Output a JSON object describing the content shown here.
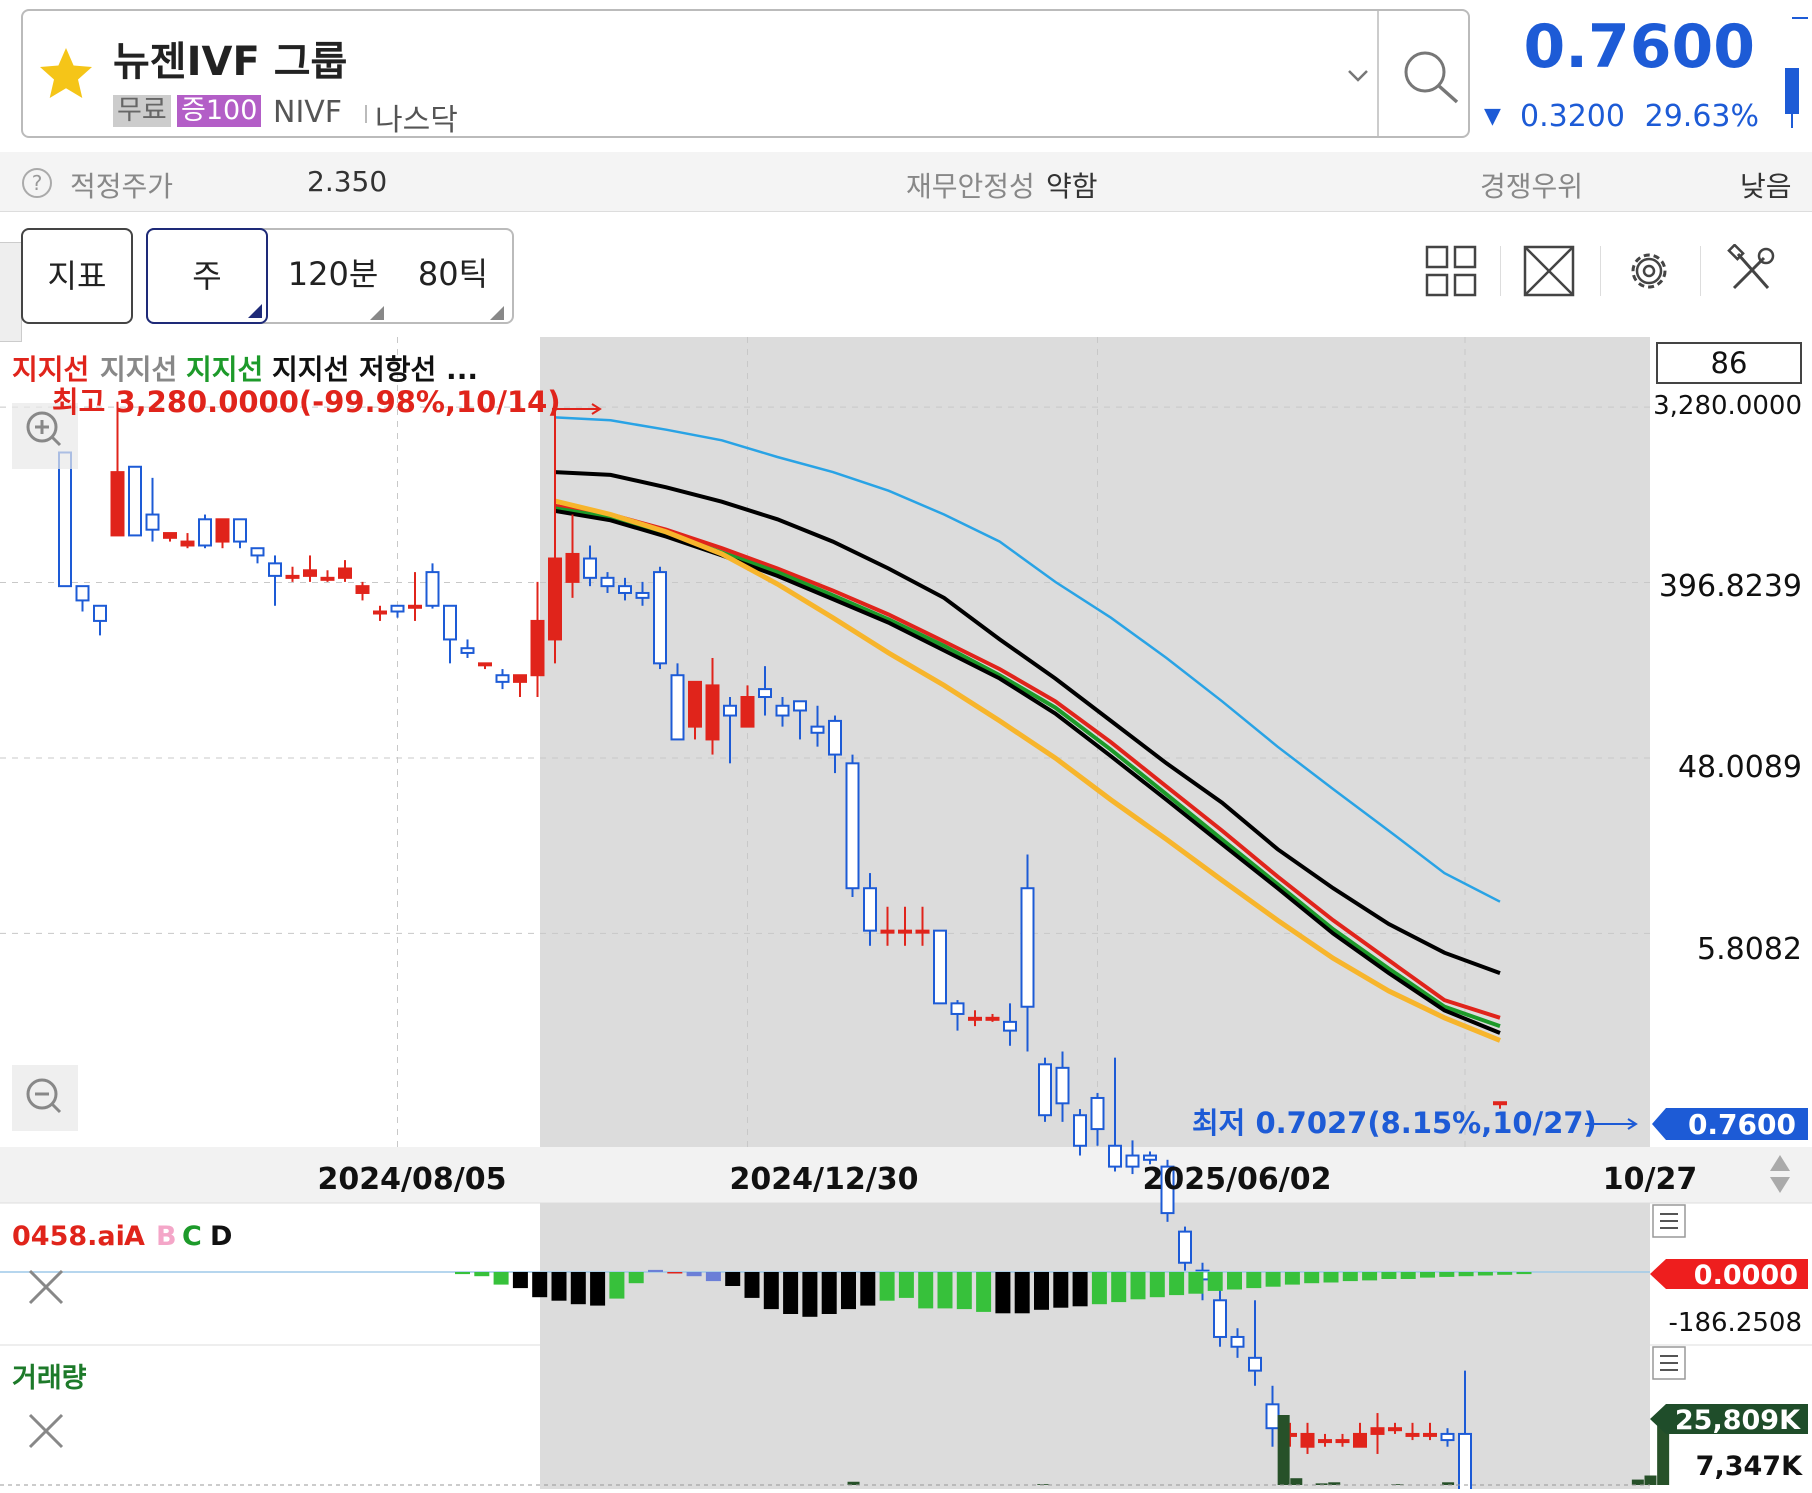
{
  "header": {
    "stock_name": "뉴젠IVF 그룹",
    "badge_free": "무료",
    "badge_margin": "증100",
    "ticker": "NIVF",
    "market": "나스닥",
    "price": "0.7600",
    "change": "0.3200",
    "change_pct": "29.63%",
    "colors": {
      "down": "#1d5bd6",
      "up": "#e0241b",
      "star": "#f5c518"
    }
  },
  "valuation": {
    "fair_price_label": "적정주가",
    "fair_price_value": "2.350",
    "stability_label": "재무안정성",
    "stability_value": "약함",
    "competitive_label": "경쟁우위",
    "competitive_value": "낮음"
  },
  "toolbar": {
    "indicator_label": "지표",
    "week_label": "주",
    "min120_label": "120분",
    "tick80_label": "80틱",
    "icons": [
      "layout-grid-icon",
      "expand-icon",
      "gear-icon",
      "tools-icon"
    ]
  },
  "chart": {
    "legend": [
      {
        "text": "지지선",
        "color": "#e0241b"
      },
      {
        "text": "지지선",
        "color": "#888888"
      },
      {
        "text": "지지선",
        "color": "#1d9a2a"
      },
      {
        "text": "지지선 저항선 ...",
        "color": "#111111"
      }
    ],
    "high_annotation": "최고 3,280.0000(-99.98%,10/14)",
    "low_annotation": "최저 0.7027(8.15%,10/27)",
    "count_box": "86",
    "current_price_tag": "0.7600",
    "y_ticks": [
      "3,280.0000",
      "396.8239",
      "48.0089",
      "5.8082"
    ],
    "x_ticks": [
      "2024/08/05",
      "2024/12/30",
      "2025/06/02",
      "10/27"
    ],
    "macd": {
      "title": "0458.ai",
      "legend": [
        {
          "text": "A",
          "color": "#e0241b"
        },
        {
          "text": "B",
          "color": "#f4a6c8"
        },
        {
          "text": "C",
          "color": "#1d9a2a"
        },
        {
          "text": "D",
          "color": "#111111"
        }
      ],
      "current_tag": "0.0000",
      "min_label": "-186.2508"
    },
    "volume": {
      "title": "거래량",
      "current_tag": "25,809K",
      "ref_label": "7,347K"
    }
  },
  "chart_data": {
    "type": "candlestick",
    "scale": "log",
    "ylim": [
      0.5,
      6000
    ],
    "y_ticks": [
      3280,
      396.8239,
      48.0089,
      5.8082
    ],
    "x_ticks": [
      "2024/08/05",
      "2024/12/30",
      "2025/06/02",
      "10/27"
    ],
    "x_tick_index": [
      19,
      39,
      59,
      80
    ],
    "candles": [
      [
        1900,
        380,
        1900,
        380
      ],
      [
        380,
        320,
        380,
        280
      ],
      [
        300,
        250,
        300,
        210
      ],
      [
        700,
        1500,
        3500,
        700
      ],
      [
        1600,
        700,
        1600,
        700
      ],
      [
        900,
        750,
        1400,
        650
      ],
      [
        680,
        720,
        720,
        650
      ],
      [
        620,
        650,
        720,
        600
      ],
      [
        850,
        620,
        900,
        600
      ],
      [
        650,
        850,
        850,
        600
      ],
      [
        850,
        650,
        850,
        600
      ],
      [
        600,
        550,
        600,
        500
      ],
      [
        500,
        430,
        550,
        300
      ],
      [
        430,
        430,
        480,
        400
      ],
      [
        430,
        460,
        550,
        400
      ],
      [
        420,
        420,
        460,
        400
      ],
      [
        420,
        470,
        520,
        400
      ],
      [
        350,
        380,
        400,
        320
      ],
      [
        280,
        280,
        300,
        250
      ],
      [
        300,
        280,
        300,
        260
      ],
      [
        300,
        300,
        450,
        250
      ],
      [
        450,
        300,
        500,
        290
      ],
      [
        300,
        200,
        300,
        150
      ],
      [
        180,
        170,
        200,
        160
      ],
      [
        150,
        150,
        150,
        140
      ],
      [
        130,
        120,
        140,
        110
      ],
      [
        120,
        130,
        130,
        100
      ],
      [
        130,
        250,
        400,
        100
      ],
      [
        200,
        530,
        3280,
        150
      ],
      [
        400,
        560,
        900,
        330
      ],
      [
        530,
        420,
        620,
        380
      ],
      [
        420,
        380,
        450,
        350
      ],
      [
        380,
        350,
        420,
        320
      ],
      [
        350,
        330,
        400,
        300
      ],
      [
        450,
        150,
        480,
        140
      ],
      [
        130,
        60,
        150,
        60
      ],
      [
        70,
        120,
        120,
        60
      ],
      [
        60,
        115,
        160,
        50
      ],
      [
        90,
        80,
        100,
        45
      ],
      [
        70,
        100,
        115,
        70
      ],
      [
        110,
        100,
        145,
        80
      ],
      [
        90,
        80,
        100,
        70
      ],
      [
        95,
        85,
        95,
        60
      ],
      [
        70,
        65,
        90,
        55
      ],
      [
        75,
        50,
        80,
        40
      ],
      [
        45,
        10,
        50,
        9
      ],
      [
        10,
        6,
        12,
        5
      ],
      [
        6,
        6,
        8,
        5
      ],
      [
        6,
        6,
        8,
        5
      ],
      [
        6,
        6,
        8,
        5
      ],
      [
        6,
        2.5,
        6,
        2.5
      ],
      [
        2.5,
        2.2,
        2.6,
        1.8
      ],
      [
        2.1,
        2.1,
        2.3,
        1.9
      ],
      [
        2.1,
        2.1,
        2.2,
        2
      ],
      [
        2,
        1.8,
        2.5,
        1.5
      ],
      [
        10,
        2.4,
        15,
        1.4
      ],
      [
        1.2,
        0.65,
        1.3,
        0.6
      ],
      [
        1.15,
        0.75,
        1.4,
        0.6
      ],
      [
        0.65,
        0.45,
        0.7,
        0.4
      ],
      [
        0.8,
        0.55,
        0.85,
        0.45
      ],
      [
        0.45,
        0.35,
        1.3,
        0.33
      ],
      [
        0.4,
        0.35,
        0.48,
        0.32
      ],
      [
        0.4,
        0.38,
        0.42,
        0.36
      ],
      [
        0.35,
        0.2,
        0.38,
        0.18
      ],
      [
        0.16,
        0.11,
        0.17,
        0.1
      ],
      [
        0.1,
        0.09,
        0.11,
        0.07
      ],
      [
        0.07,
        0.045,
        0.08,
        0.04
      ],
      [
        0.045,
        0.04,
        0.05,
        0.035
      ],
      [
        0.035,
        0.03,
        0.07,
        0.025
      ],
      [
        0.02,
        0.015,
        0.025,
        0.012
      ],
      [
        0.014,
        0.014,
        0.016,
        0.012
      ],
      [
        0.012,
        0.014,
        0.016,
        0.011
      ],
      [
        0.013,
        0.013,
        0.014,
        0.012
      ],
      [
        0.013,
        0.013,
        0.014,
        0.012
      ],
      [
        0.012,
        0.014,
        0.016,
        0.012
      ],
      [
        0.014,
        0.015,
        0.018,
        0.011
      ],
      [
        0.015,
        0.015,
        0.016,
        0.014
      ],
      [
        0.014,
        0.014,
        0.016,
        0.013
      ],
      [
        0.014,
        0.014,
        0.016,
        0.013
      ],
      [
        0.014,
        0.013,
        0.015,
        0.012
      ],
      [
        0.014,
        0.005,
        0.03,
        0.004
      ],
      [
        0.004,
        0.004,
        0.0045,
        0.0035
      ],
      [
        0.76,
        0.76,
        0.76,
        0.7027
      ]
    ],
    "ma_series": [
      {
        "color": "#29a3e5",
        "values": [
          2900,
          2800,
          2500,
          2200,
          1800,
          1500,
          1200,
          900,
          650,
          400,
          260,
          160,
          95,
          55,
          33,
          20,
          12,
          8.5
        ]
      },
      {
        "color": "#000000",
        "values": [
          1500,
          1450,
          1250,
          1050,
          850,
          650,
          470,
          330,
          200,
          125,
          75,
          45,
          28,
          16,
          10,
          6.5,
          4.6,
          3.6
        ]
      },
      {
        "color": "#e0241b",
        "values": [
          1000,
          900,
          750,
          600,
          470,
          360,
          270,
          195,
          140,
          95,
          58,
          34,
          20,
          11.5,
          6.8,
          4.2,
          2.6,
          2.1
        ]
      },
      {
        "color": "#1d9a2a",
        "values": [
          970,
          870,
          720,
          570,
          450,
          340,
          255,
          185,
          130,
          88,
          53,
          31,
          18,
          10.5,
          6.1,
          3.8,
          2.4,
          1.9
        ]
      },
      {
        "color": "#000000",
        "values": [
          940,
          840,
          690,
          550,
          430,
          325,
          245,
          175,
          125,
          82,
          49,
          29,
          17,
          10,
          5.8,
          3.6,
          2.3,
          1.75
        ]
      },
      {
        "color": "#f7b52c",
        "values": [
          1060,
          900,
          730,
          560,
          390,
          260,
          170,
          115,
          75,
          48,
          29,
          18,
          11,
          6.8,
          4.3,
          2.9,
          2.1,
          1.6
        ]
      }
    ],
    "high": 3280,
    "low": 0.7027,
    "macd_values": [
      -3,
      -6,
      -18,
      -23,
      -36,
      -41,
      -46,
      -48,
      -38,
      -16,
      3,
      -1,
      -6,
      -13,
      -20,
      -37,
      -53,
      -60,
      -64,
      -60,
      -53,
      -48,
      -41,
      -37,
      -52,
      -52,
      -53,
      -57,
      -59,
      -59,
      -54,
      -51,
      -49,
      -46,
      -43,
      -39,
      -36,
      -33,
      -31,
      -27,
      -25,
      -23,
      -21,
      -18,
      -16,
      -15,
      -13,
      -12,
      -10,
      -10,
      -8,
      -7,
      -6,
      -5,
      -4,
      -3
    ],
    "macd_colors": "gggkkkkkgg/r//kkkkkkkkggggggkkkkkggggggggggggggggggggggggggggg",
    "volume_values": [
      0,
      0,
      0,
      0,
      0,
      0,
      0,
      0,
      0,
      0,
      0,
      0,
      0,
      0,
      0,
      0,
      0,
      0,
      0,
      0,
      0,
      0,
      0,
      0,
      0,
      0,
      0,
      0,
      0,
      0,
      0,
      0,
      0,
      0,
      0,
      0,
      0,
      0,
      0,
      0,
      0,
      0,
      0,
      0,
      0,
      0,
      0,
      0,
      0,
      0,
      0,
      0,
      0,
      0,
      0,
      0,
      0,
      0,
      0,
      0,
      0,
      0,
      0,
      0,
      0,
      0,
      0,
      1200,
      0,
      0,
      0,
      0,
      0,
      0,
      0,
      0,
      0,
      0,
      0,
      0,
      0,
      0,
      300,
      0,
      0,
      0,
      0,
      0,
      0,
      0,
      0,
      0,
      0,
      0,
      0,
      0,
      0,
      0,
      0,
      0,
      0,
      25809,
      2500,
      0,
      600,
      1000,
      0,
      0,
      0,
      0,
      300,
      0,
      0,
      0,
      1000,
      0,
      0,
      0,
      0,
      0,
      0,
      0,
      0,
      0,
      0,
      0,
      0,
      0,
      0,
      2000,
      3500,
      25809
    ]
  }
}
